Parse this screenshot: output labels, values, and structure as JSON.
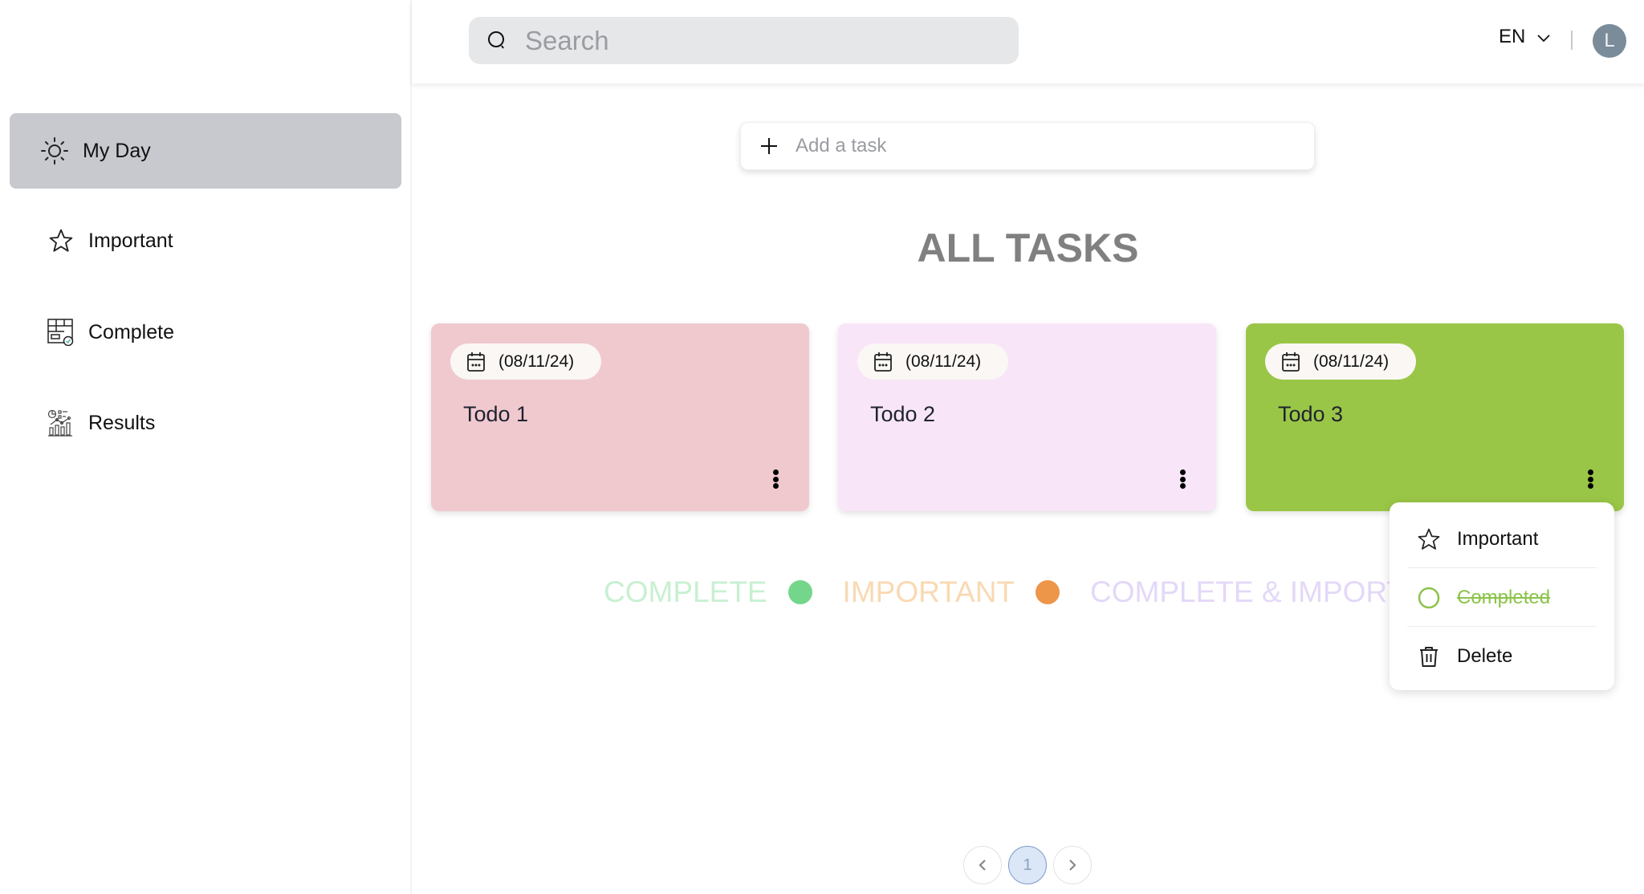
{
  "sidebar": {
    "items": [
      {
        "label": "My Day",
        "icon": "sun-icon",
        "active": true
      },
      {
        "label": "Important",
        "icon": "star-icon",
        "active": false
      },
      {
        "label": "Complete",
        "icon": "checklist-icon",
        "active": false
      },
      {
        "label": "Results",
        "icon": "analytics-icon",
        "active": false
      }
    ]
  },
  "header": {
    "search": {
      "placeholder": "Search",
      "value": ""
    },
    "language": "EN",
    "avatar_initial": "L"
  },
  "add_task": {
    "placeholder": "Add a task",
    "value": ""
  },
  "main": {
    "title": "ALL TASKS",
    "tasks": [
      {
        "date": "(08/11/24)",
        "title": "Todo 1",
        "color": "#f0c9cf"
      },
      {
        "date": "(08/11/24)",
        "title": "Todo 2",
        "color": "#f8e6f8"
      },
      {
        "date": "(08/11/24)",
        "title": "Todo 3",
        "color": "#9ac647"
      }
    ],
    "legend": [
      {
        "label": "COMPLETE",
        "text_color": "#c8f0d2",
        "dot_color": "#74d68a"
      },
      {
        "label": "IMPORTANT",
        "text_color": "#f9d9b2",
        "dot_color": "#ed9549"
      },
      {
        "label": "COMPLETE & IMPORTANT",
        "text_color": "#e4d8f8"
      }
    ]
  },
  "context_menu": {
    "items": [
      {
        "label": "Important",
        "icon": "star-icon"
      },
      {
        "label": "Completed",
        "icon": "circle-icon",
        "strikethrough": true,
        "color": "#8cc34a"
      },
      {
        "label": "Delete",
        "icon": "trash-icon"
      }
    ]
  },
  "pagination": {
    "current_page": "1"
  }
}
